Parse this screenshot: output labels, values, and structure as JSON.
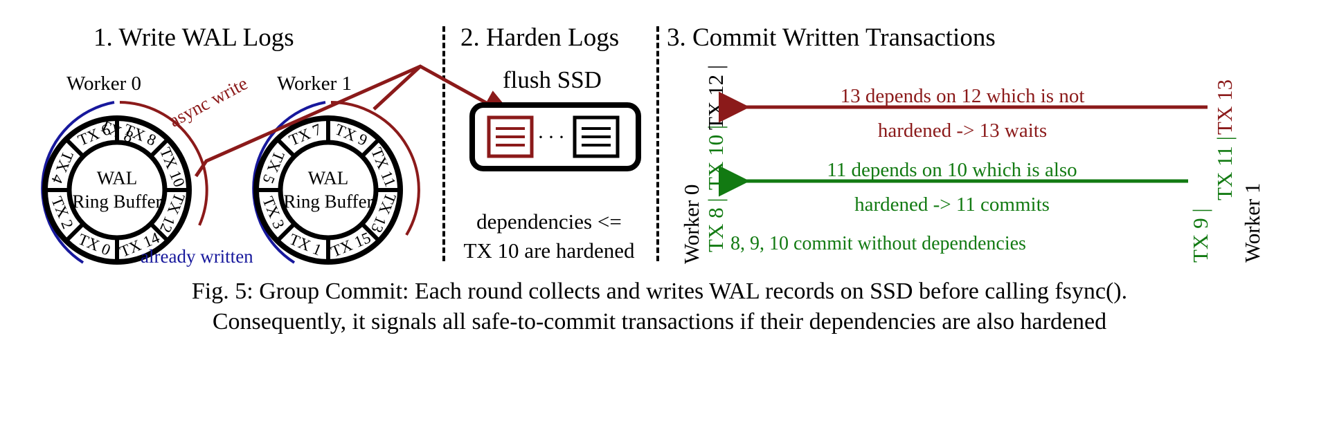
{
  "figure": {
    "caption_line1": "Fig. 5: Group Commit: Each round collects and writes WAL records on SSD before calling fsync().",
    "caption_line2": "Consequently, it signals all safe-to-commit transactions if their dependencies are also hardened"
  },
  "colors": {
    "dark_red": "#8b1a1a",
    "green": "#127a12",
    "blue": "#17189c",
    "black": "#000000"
  },
  "panels": [
    {
      "id": "write",
      "title": "1. Write WAL Logs"
    },
    {
      "id": "harden",
      "title": "2. Harden Logs"
    },
    {
      "id": "commit",
      "title": "3. Commit Written Transactions"
    }
  ],
  "panel1": {
    "async_write_label": "async write",
    "already_written_label": "already written",
    "workers": [
      {
        "name": "Worker 0",
        "center_line1": "WAL",
        "center_line2": "Ring Buffer",
        "slots": [
          "TX 8",
          "TX 10",
          "TX 12",
          "TX 14",
          "TX 0",
          "TX 2",
          "TX 4",
          "TX 6"
        ]
      },
      {
        "name": "Worker 1",
        "center_line1": "WAL",
        "center_line2": "Ring Buffer",
        "slots": [
          "TX 9",
          "TX 11",
          "TX 13",
          "TX 15",
          "TX 1",
          "TX 3",
          "TX 5",
          "TX 7"
        ]
      }
    ]
  },
  "panel2": {
    "flush_label": "flush SSD",
    "note_line1": "dependencies <=",
    "note_line2": "TX 10 are hardened",
    "ellipsis": "···"
  },
  "panel3": {
    "left_worker_label": "Worker 0",
    "right_worker_label": "Worker 1",
    "left_tx": [
      {
        "label": "TX 12",
        "color": "black"
      },
      {
        "label": "TX 10",
        "color": "green"
      },
      {
        "label": "TX 8",
        "color": "green"
      }
    ],
    "right_tx": [
      {
        "label": "TX 13",
        "color": "dark_red"
      },
      {
        "label": "TX 11",
        "color": "green"
      },
      {
        "label": "TX 9",
        "color": "green"
      }
    ],
    "separator": "|",
    "annotations": [
      {
        "color": "dark_red",
        "line1": "13 depends on 12 which is not",
        "line2": "hardened -> 13 waits"
      },
      {
        "color": "green",
        "line1": "11 depends on 10 which is also",
        "line2": "hardened -> 11 commits"
      }
    ],
    "bottom_note": "8, 9, 10 commit without dependencies"
  }
}
